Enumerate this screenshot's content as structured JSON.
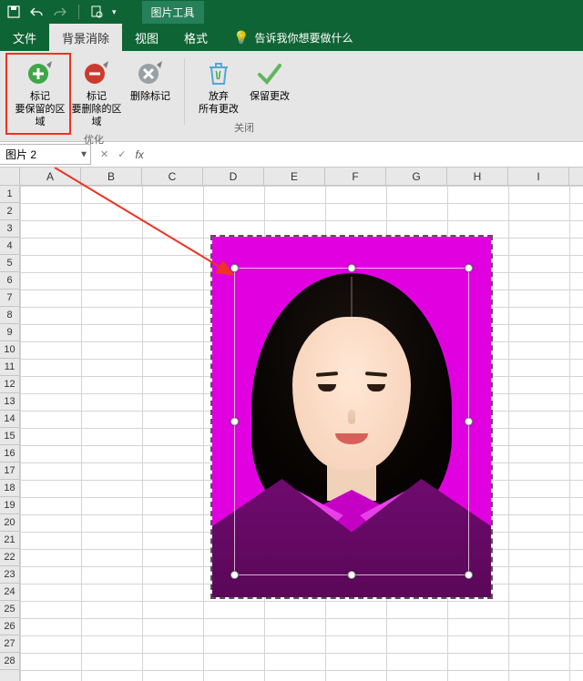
{
  "qat": {
    "context_tab": "图片工具"
  },
  "tabs": {
    "file": "文件",
    "bgremove": "背景消除",
    "view": "视图",
    "format": "格式",
    "tellme": "告诉我你想要做什么"
  },
  "ribbon": {
    "keep": {
      "title": "标记",
      "sub": "要保留的区域"
    },
    "remove": {
      "title": "标记",
      "sub": "要删除的区域"
    },
    "delmark": "删除标记",
    "group1": "优化",
    "discard": {
      "title": "放弃",
      "sub": "所有更改"
    },
    "keepchanges": "保留更改",
    "group2": "关闭"
  },
  "namebox": "图片 2",
  "fx_label": "fx",
  "columns": [
    "A",
    "B",
    "C",
    "D",
    "E",
    "F",
    "G",
    "H",
    "I"
  ],
  "rows": [
    "1",
    "2",
    "3",
    "4",
    "5",
    "6",
    "7",
    "8",
    "9",
    "10",
    "11",
    "12",
    "13",
    "14",
    "15",
    "16",
    "17",
    "18",
    "19",
    "20",
    "21",
    "22",
    "23",
    "24",
    "25",
    "26",
    "27",
    "28"
  ]
}
